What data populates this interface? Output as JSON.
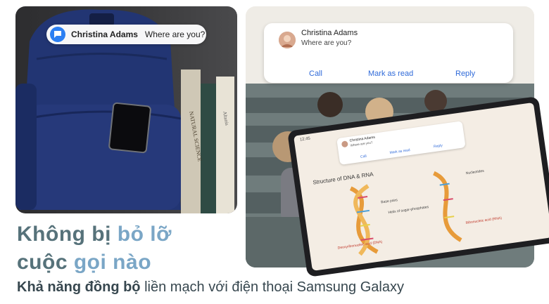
{
  "left_toast": {
    "icon": "chat-bubble-icon",
    "sender": "Christina Adams",
    "message": "Where are you?"
  },
  "book_spines": {
    "book1": "NATURAL SCIENCE",
    "book2": "Altanis"
  },
  "notification": {
    "sender": "Christina Adams",
    "message": "Where are you?",
    "actions": {
      "call": "Call",
      "mark_as_read": "Mark as read",
      "reply": "Reply"
    }
  },
  "tablet": {
    "status_time": "12:45",
    "mini_notification": {
      "sender": "Christina Adams",
      "message": "Where are you?",
      "actions": {
        "call": "Call",
        "mark_as_read": "Mark as read",
        "reply": "Reply"
      }
    },
    "notes": {
      "title": "Structure of DNA & RNA",
      "nucleotides": "Nucleotides",
      "base_pairs": "Base pairs",
      "helix": "Helix of sugar-phosphates",
      "dna": "Deoxyribonucleic acid (DNA)",
      "rna": "Ribonucleic acid (RNA)"
    }
  },
  "headline": {
    "line1_part1": "Không bị ",
    "line1_accent": "bỏ lỡ",
    "line2_part1": "cuộc ",
    "line2_accent": "gọi nào"
  },
  "subline": {
    "bold": "Khả năng đồng bộ",
    "rest": " liền mạch với điện thoại Samsung Galaxy"
  },
  "colors": {
    "headline": "#56727a",
    "headline_accent": "#7aa6c6",
    "link": "#2f6ad9",
    "toast_icon": "#2c7ff2"
  }
}
